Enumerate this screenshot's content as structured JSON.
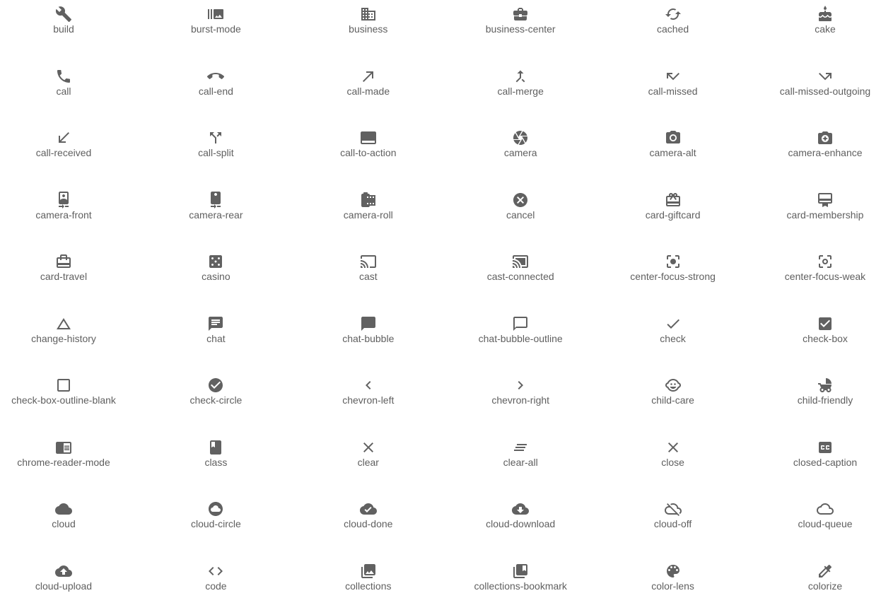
{
  "icons": [
    {
      "label": "build",
      "icon": "build-icon"
    },
    {
      "label": "burst-mode",
      "icon": "burst-mode-icon"
    },
    {
      "label": "business",
      "icon": "business-icon"
    },
    {
      "label": "business-center",
      "icon": "business-center-icon"
    },
    {
      "label": "cached",
      "icon": "cached-icon"
    },
    {
      "label": "cake",
      "icon": "cake-icon"
    },
    {
      "label": "call",
      "icon": "call-icon"
    },
    {
      "label": "call-end",
      "icon": "call-end-icon"
    },
    {
      "label": "call-made",
      "icon": "call-made-icon"
    },
    {
      "label": "call-merge",
      "icon": "call-merge-icon"
    },
    {
      "label": "call-missed",
      "icon": "call-missed-icon"
    },
    {
      "label": "call-missed-outgoing",
      "icon": "call-missed-outgoing-icon"
    },
    {
      "label": "call-received",
      "icon": "call-received-icon"
    },
    {
      "label": "call-split",
      "icon": "call-split-icon"
    },
    {
      "label": "call-to-action",
      "icon": "call-to-action-icon"
    },
    {
      "label": "camera",
      "icon": "camera-icon"
    },
    {
      "label": "camera-alt",
      "icon": "camera-alt-icon"
    },
    {
      "label": "camera-enhance",
      "icon": "camera-enhance-icon"
    },
    {
      "label": "camera-front",
      "icon": "camera-front-icon"
    },
    {
      "label": "camera-rear",
      "icon": "camera-rear-icon"
    },
    {
      "label": "camera-roll",
      "icon": "camera-roll-icon"
    },
    {
      "label": "cancel",
      "icon": "cancel-icon"
    },
    {
      "label": "card-giftcard",
      "icon": "card-giftcard-icon"
    },
    {
      "label": "card-membership",
      "icon": "card-membership-icon"
    },
    {
      "label": "card-travel",
      "icon": "card-travel-icon"
    },
    {
      "label": "casino",
      "icon": "casino-icon"
    },
    {
      "label": "cast",
      "icon": "cast-icon"
    },
    {
      "label": "cast-connected",
      "icon": "cast-connected-icon"
    },
    {
      "label": "center-focus-strong",
      "icon": "center-focus-strong-icon"
    },
    {
      "label": "center-focus-weak",
      "icon": "center-focus-weak-icon"
    },
    {
      "label": "change-history",
      "icon": "change-history-icon"
    },
    {
      "label": "chat",
      "icon": "chat-icon"
    },
    {
      "label": "chat-bubble",
      "icon": "chat-bubble-icon"
    },
    {
      "label": "chat-bubble-outline",
      "icon": "chat-bubble-outline-icon"
    },
    {
      "label": "check",
      "icon": "check-icon"
    },
    {
      "label": "check-box",
      "icon": "check-box-icon"
    },
    {
      "label": "check-box-outline-blank",
      "icon": "check-box-outline-blank-icon"
    },
    {
      "label": "check-circle",
      "icon": "check-circle-icon"
    },
    {
      "label": "chevron-left",
      "icon": "chevron-left-icon"
    },
    {
      "label": "chevron-right",
      "icon": "chevron-right-icon"
    },
    {
      "label": "child-care",
      "icon": "child-care-icon"
    },
    {
      "label": "child-friendly",
      "icon": "child-friendly-icon"
    },
    {
      "label": "chrome-reader-mode",
      "icon": "chrome-reader-mode-icon"
    },
    {
      "label": "class",
      "icon": "class-icon"
    },
    {
      "label": "clear",
      "icon": "clear-icon"
    },
    {
      "label": "clear-all",
      "icon": "clear-all-icon"
    },
    {
      "label": "close",
      "icon": "close-icon"
    },
    {
      "label": "closed-caption",
      "icon": "closed-caption-icon"
    },
    {
      "label": "cloud",
      "icon": "cloud-icon"
    },
    {
      "label": "cloud-circle",
      "icon": "cloud-circle-icon"
    },
    {
      "label": "cloud-done",
      "icon": "cloud-done-icon"
    },
    {
      "label": "cloud-download",
      "icon": "cloud-download-icon"
    },
    {
      "label": "cloud-off",
      "icon": "cloud-off-icon"
    },
    {
      "label": "cloud-queue",
      "icon": "cloud-queue-icon"
    },
    {
      "label": "cloud-upload",
      "icon": "cloud-upload-icon"
    },
    {
      "label": "code",
      "icon": "code-icon"
    },
    {
      "label": "collections",
      "icon": "collections-icon"
    },
    {
      "label": "collections-bookmark",
      "icon": "collections-bookmark-icon"
    },
    {
      "label": "color-lens",
      "icon": "color-lens-icon"
    },
    {
      "label": "colorize",
      "icon": "colorize-icon"
    }
  ],
  "colors": {
    "icon": "#616161",
    "text": "#5f5f5f",
    "background": "#ffffff"
  }
}
